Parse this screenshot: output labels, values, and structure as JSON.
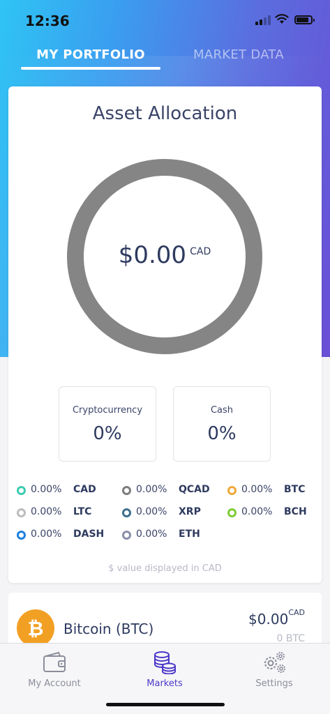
{
  "status_bar": {
    "time": "12:36"
  },
  "tabs": [
    {
      "label": "MY PORTFOLIO",
      "active": true
    },
    {
      "label": "MARKET DATA",
      "active": false
    }
  ],
  "allocation": {
    "title": "Asset Allocation",
    "total": "$0.00",
    "currency": "CAD",
    "summary": [
      {
        "label": "Cryptocurrency",
        "value": "0%"
      },
      {
        "label": "Cash",
        "value": "0%"
      }
    ],
    "legend": [
      {
        "pct": "0.00%",
        "symbol": "CAD",
        "color": "#3ccdb0"
      },
      {
        "pct": "0.00%",
        "symbol": "QCAD",
        "color": "#7d7d7d"
      },
      {
        "pct": "0.00%",
        "symbol": "BTC",
        "color": "#f0a93b"
      },
      {
        "pct": "0.00%",
        "symbol": "LTC",
        "color": "#bcbcbc"
      },
      {
        "pct": "0.00%",
        "symbol": "XRP",
        "color": "#3d6f8e"
      },
      {
        "pct": "0.00%",
        "symbol": "BCH",
        "color": "#7fcb34"
      },
      {
        "pct": "0.00%",
        "symbol": "DASH",
        "color": "#1e7fe0"
      },
      {
        "pct": "0.00%",
        "symbol": "ETH",
        "color": "#8b8fa8"
      }
    ],
    "note": "$ value displayed in CAD"
  },
  "coin": {
    "name": "Bitcoin (BTC)",
    "value": "$0.00",
    "currency": "CAD",
    "amount": "0 BTC",
    "icon": "bitcoin-icon",
    "color": "#f2a024"
  },
  "bottom_nav": [
    {
      "label": "My Account",
      "icon": "wallet-icon",
      "active": false
    },
    {
      "label": "Markets",
      "icon": "coins-stack-icon",
      "active": true
    },
    {
      "label": "Settings",
      "icon": "gears-icon",
      "active": false
    }
  ],
  "colors": {
    "accent": "#4b38c9",
    "text": "#2e3a5f",
    "donut": "#858585"
  }
}
